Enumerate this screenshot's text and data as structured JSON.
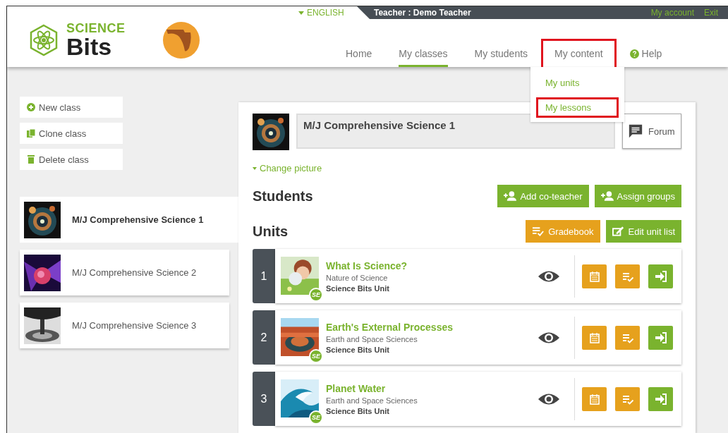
{
  "header": {
    "language": "ENGLISH",
    "user": "Teacher : Demo Teacher",
    "account_links": [
      "My account",
      "Exit"
    ],
    "nav": [
      {
        "label": "Home",
        "selected": false,
        "highlighted": false
      },
      {
        "label": "My classes",
        "selected": true,
        "highlighted": false
      },
      {
        "label": "My students",
        "selected": false,
        "highlighted": false
      },
      {
        "label": "My content",
        "selected": false,
        "highlighted": true
      }
    ],
    "help": "Help",
    "dropdown": [
      {
        "label": "My units",
        "highlighted": false
      },
      {
        "label": "My lessons",
        "highlighted": true
      }
    ]
  },
  "logo": {
    "line1": "SCIENCE",
    "line2": "Bits"
  },
  "actions": [
    {
      "label": "New class",
      "kind": "new"
    },
    {
      "label": "Clone class",
      "kind": "clone"
    },
    {
      "label": "Delete class",
      "kind": "delete"
    }
  ],
  "classes": [
    {
      "name": "M/J Comprehensive Science 1",
      "selected": true
    },
    {
      "name": "M/J Comprehensive Science 2",
      "selected": false
    },
    {
      "name": "M/J Comprehensive Science 3",
      "selected": false
    }
  ],
  "class_detail": {
    "name": "M/J Comprehensive Science 1",
    "forum": "Forum",
    "change_picture": "Change picture",
    "students_heading": "Students",
    "student_buttons": [
      {
        "label": "Add co-teacher",
        "kind": "person"
      },
      {
        "label": "Assign groups",
        "kind": "person"
      }
    ],
    "units_heading": "Units",
    "unit_buttons": [
      {
        "label": "Gradebook",
        "kind": "gradebook"
      },
      {
        "label": "Edit unit list",
        "kind": "edit"
      }
    ],
    "units": [
      {
        "number": "1",
        "title": "What Is Science?",
        "subject": "Nature of Science",
        "type": "Science Bits Unit",
        "badge": "SE"
      },
      {
        "number": "2",
        "title": "Earth's External Processes",
        "subject": "Earth and Space Sciences",
        "type": "Science Bits Unit",
        "badge": "SE"
      },
      {
        "number": "3",
        "title": "Planet Water",
        "subject": "Earth and Space Sciences",
        "type": "Science Bits Unit",
        "badge": "SE"
      }
    ]
  }
}
